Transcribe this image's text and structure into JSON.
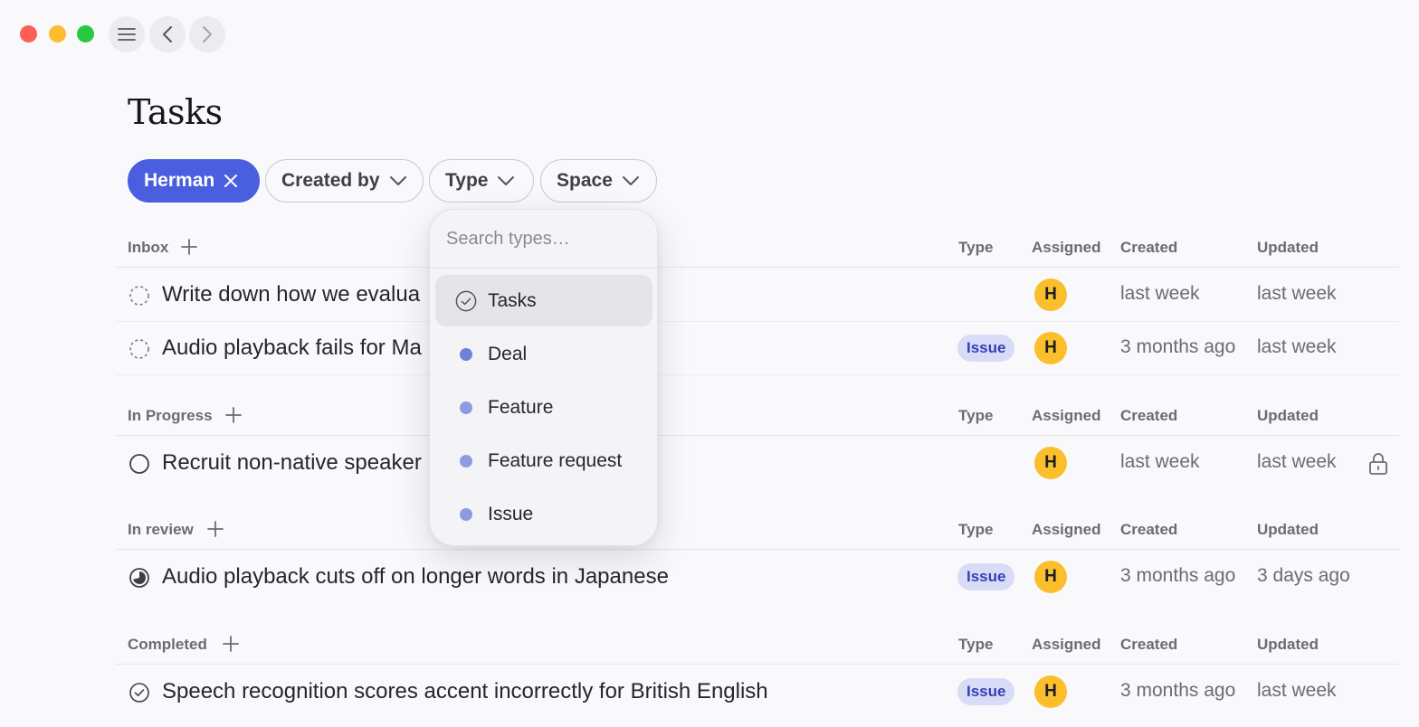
{
  "window": {
    "controls": [
      "close",
      "minimize",
      "maximize"
    ],
    "nav_icons": [
      "menu-icon",
      "chevron-left-icon",
      "chevron-right-icon"
    ]
  },
  "page": {
    "title": "Tasks"
  },
  "filters": {
    "active": {
      "label": "Herman",
      "icon": "close-icon"
    },
    "chips": [
      {
        "label": "Created by",
        "icon": "chevron-down-icon"
      },
      {
        "label": "Type",
        "icon": "chevron-down-icon"
      },
      {
        "label": "Space",
        "icon": "chevron-down-icon"
      }
    ]
  },
  "columns": {
    "type": "Type",
    "assigned": "Assigned",
    "created": "Created",
    "updated": "Updated"
  },
  "sections": [
    {
      "name": "Inbox",
      "rows": [
        {
          "status": "dashed-circle-icon",
          "title": "Write down how we evalua",
          "type": "",
          "assignee": "H",
          "created": "last week",
          "updated": "last week"
        },
        {
          "status": "dashed-circle-icon",
          "title": "Audio playback fails for Ma",
          "type": "Issue",
          "assignee": "H",
          "created": "3 months ago",
          "updated": "last week"
        }
      ]
    },
    {
      "name": "In Progress",
      "rows": [
        {
          "status": "empty-circle-icon",
          "title": "Recruit non-native speaker",
          "type": "",
          "assignee": "H",
          "created": "last week",
          "updated": "last week",
          "locked": true
        }
      ]
    },
    {
      "name": "In review",
      "rows": [
        {
          "status": "half-circle-icon",
          "title": "Audio playback cuts off on longer words in Japanese",
          "type": "Issue",
          "assignee": "H",
          "created": "3 months ago",
          "updated": "3 days ago"
        }
      ]
    },
    {
      "name": "Completed",
      "rows": [
        {
          "status": "check-circle-icon",
          "title": "Speech recognition scores accent incorrectly for British English",
          "type": "Issue",
          "assignee": "H",
          "created": "3 months ago",
          "updated": "last week"
        }
      ]
    }
  ],
  "type_dropdown": {
    "placeholder": "Search types…",
    "items": [
      {
        "label": "Tasks",
        "icon": "check-circle-icon",
        "selected": true
      },
      {
        "label": "Deal",
        "color": "#6f80d8"
      },
      {
        "label": "Feature",
        "color": "#8e9be0"
      },
      {
        "label": "Feature request",
        "color": "#8e9be0"
      },
      {
        "label": "Issue",
        "color": "#8e9be0"
      }
    ]
  },
  "colors": {
    "accent": "#4a5fe0",
    "issue_badge_bg": "#d9dcf7",
    "issue_badge_text": "#3340b8",
    "avatar": "#fbbf2c",
    "traffic_red": "#fe5f57",
    "traffic_yellow": "#febc2e",
    "traffic_green": "#28c840"
  }
}
